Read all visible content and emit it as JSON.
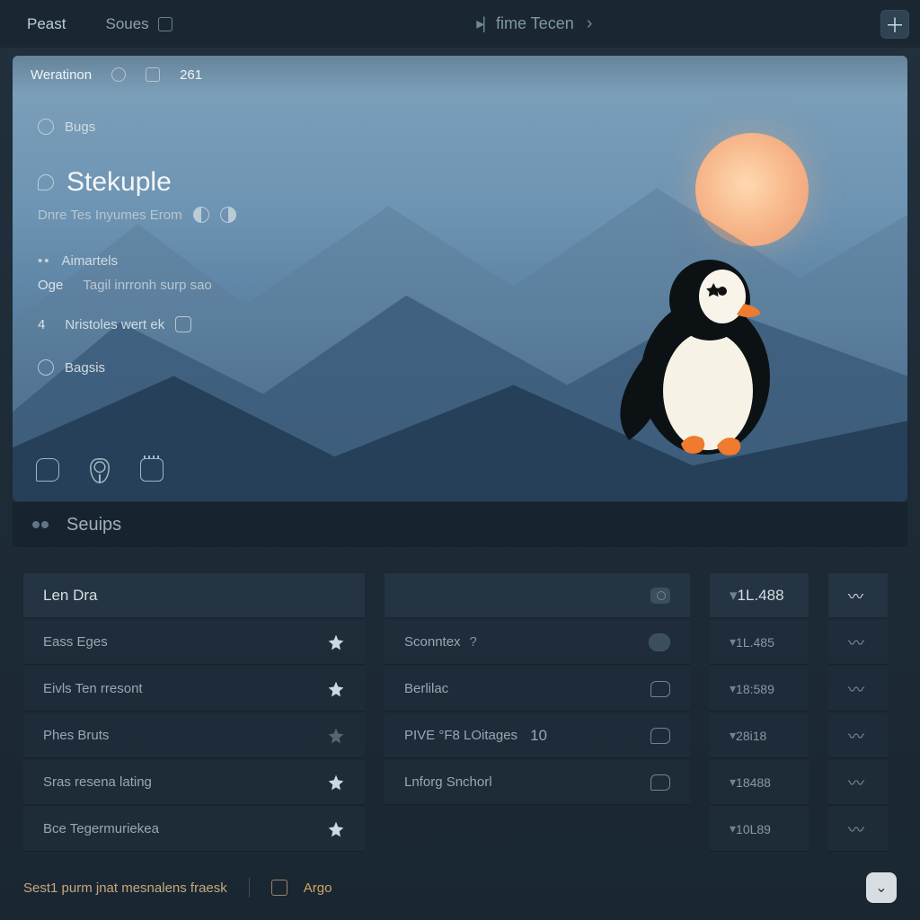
{
  "tabs": {
    "left": {
      "label": "Peast"
    },
    "second": {
      "label": "Soues"
    },
    "center": {
      "label": "fime Tecen"
    }
  },
  "hero": {
    "strip": {
      "label": "Weratinon",
      "count": "261"
    },
    "crumb": {
      "label": "Bugs"
    },
    "title": "Stekuple",
    "subtitle": "Dnre Tes Inyumes Erom",
    "items": [
      {
        "label": "Aimartels"
      },
      {
        "label": "Tagil inrronh surp sao",
        "prefix": "Oge"
      },
      {
        "label": "Nristoles wert ek",
        "prefix": "4"
      },
      {
        "label": "Bagsis"
      }
    ]
  },
  "section": {
    "title": "Seuips"
  },
  "lists": {
    "left": [
      {
        "label": "Len Dra",
        "head": true
      },
      {
        "label": "Eass Eges",
        "star": true
      },
      {
        "label": "Eivls Ten rresont",
        "star": true
      },
      {
        "label": "Phes Bruts",
        "star": false
      },
      {
        "label": "Sras resena lating",
        "star": true
      },
      {
        "label": "Bce Tegermuriekea",
        "star": true
      }
    ],
    "right": [
      {
        "label": "",
        "head": true,
        "icon": "camera"
      },
      {
        "label": "Sconntex",
        "suffix": "?",
        "icon": "phone"
      },
      {
        "label": "Berlilac",
        "icon": "chat"
      },
      {
        "label": "PIVE °F8 LOitages",
        "count": "10",
        "icon": "chat"
      },
      {
        "label": "Lnforg Snchorl",
        "icon": "chat"
      }
    ],
    "meta": [
      "1L.488",
      "1L.485",
      "18:589",
      "28i18",
      "18488",
      "10L89"
    ]
  },
  "footer": {
    "text": "Sest1 purm jnat mesnalens fraesk",
    "ago": "Argo"
  }
}
